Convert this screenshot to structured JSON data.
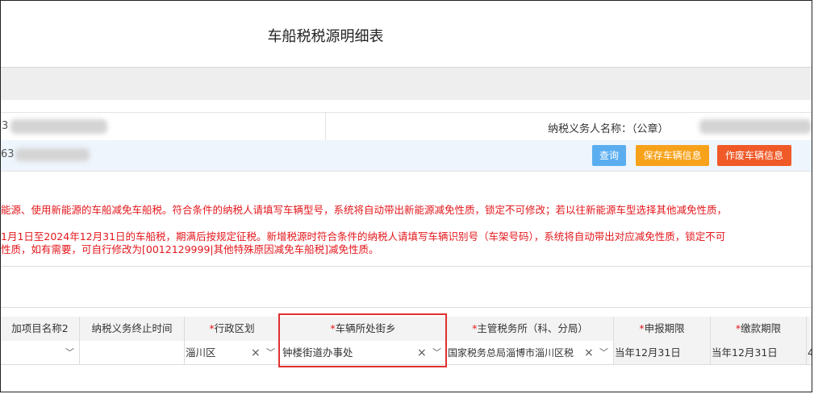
{
  "page": {
    "title": "车船税税源明细表"
  },
  "info": {
    "row1_left_fragment": "3",
    "taxpayer_label": "纳税义务人名称：（公章）",
    "row2_left_fragment": "63"
  },
  "buttons": {
    "query": "查询",
    "save": "保存车辆信息",
    "void": "作废车辆信息"
  },
  "notice": {
    "line1": "能源、使用新能源的车船减免车船税。符合条件的纳税人请填写车辆型号，系统将自动带出新能源减免性质，锁定不可修改；若以往新能源车型选择其他减免性质，",
    "line2": "1月1日至2024年12月31日的车船税，期满后按规定征税。新增税源时符合条件的纳税人请填写车辆识别号（车架号码），系统将自动带出对应减免性质，锁定不可",
    "line3": "性质，如有需要，可自行修改为[0012129999|其他特殊原因减免车船税]减免性质。"
  },
  "table": {
    "headers": {
      "item_name": "加项目名称2",
      "end_time": "纳税义务终止时间",
      "region": "行政区划",
      "street": "车辆所处街乡",
      "tax_office": "主管税务所（科、分局）",
      "report_period": "申报期限",
      "pay_period": "缴款期限",
      "required_mark": "*"
    },
    "row": {
      "item_name": "",
      "end_time": "",
      "region": "淄川区",
      "street": "钟楼街道办事处",
      "tax_office": "国家税务总局淄博市淄川区税",
      "report_period": "当年12月31日",
      "pay_period": "当年12月31日",
      "last_fragment": "4"
    }
  },
  "icons": {
    "clear": "close-icon",
    "dropdown": "chevron-down-icon"
  },
  "colors": {
    "notice_red": "#e4171c",
    "query_btn": "#5aaef0",
    "save_btn": "#f7a21b",
    "void_btn": "#f05a28",
    "highlight_border": "#e03030"
  }
}
